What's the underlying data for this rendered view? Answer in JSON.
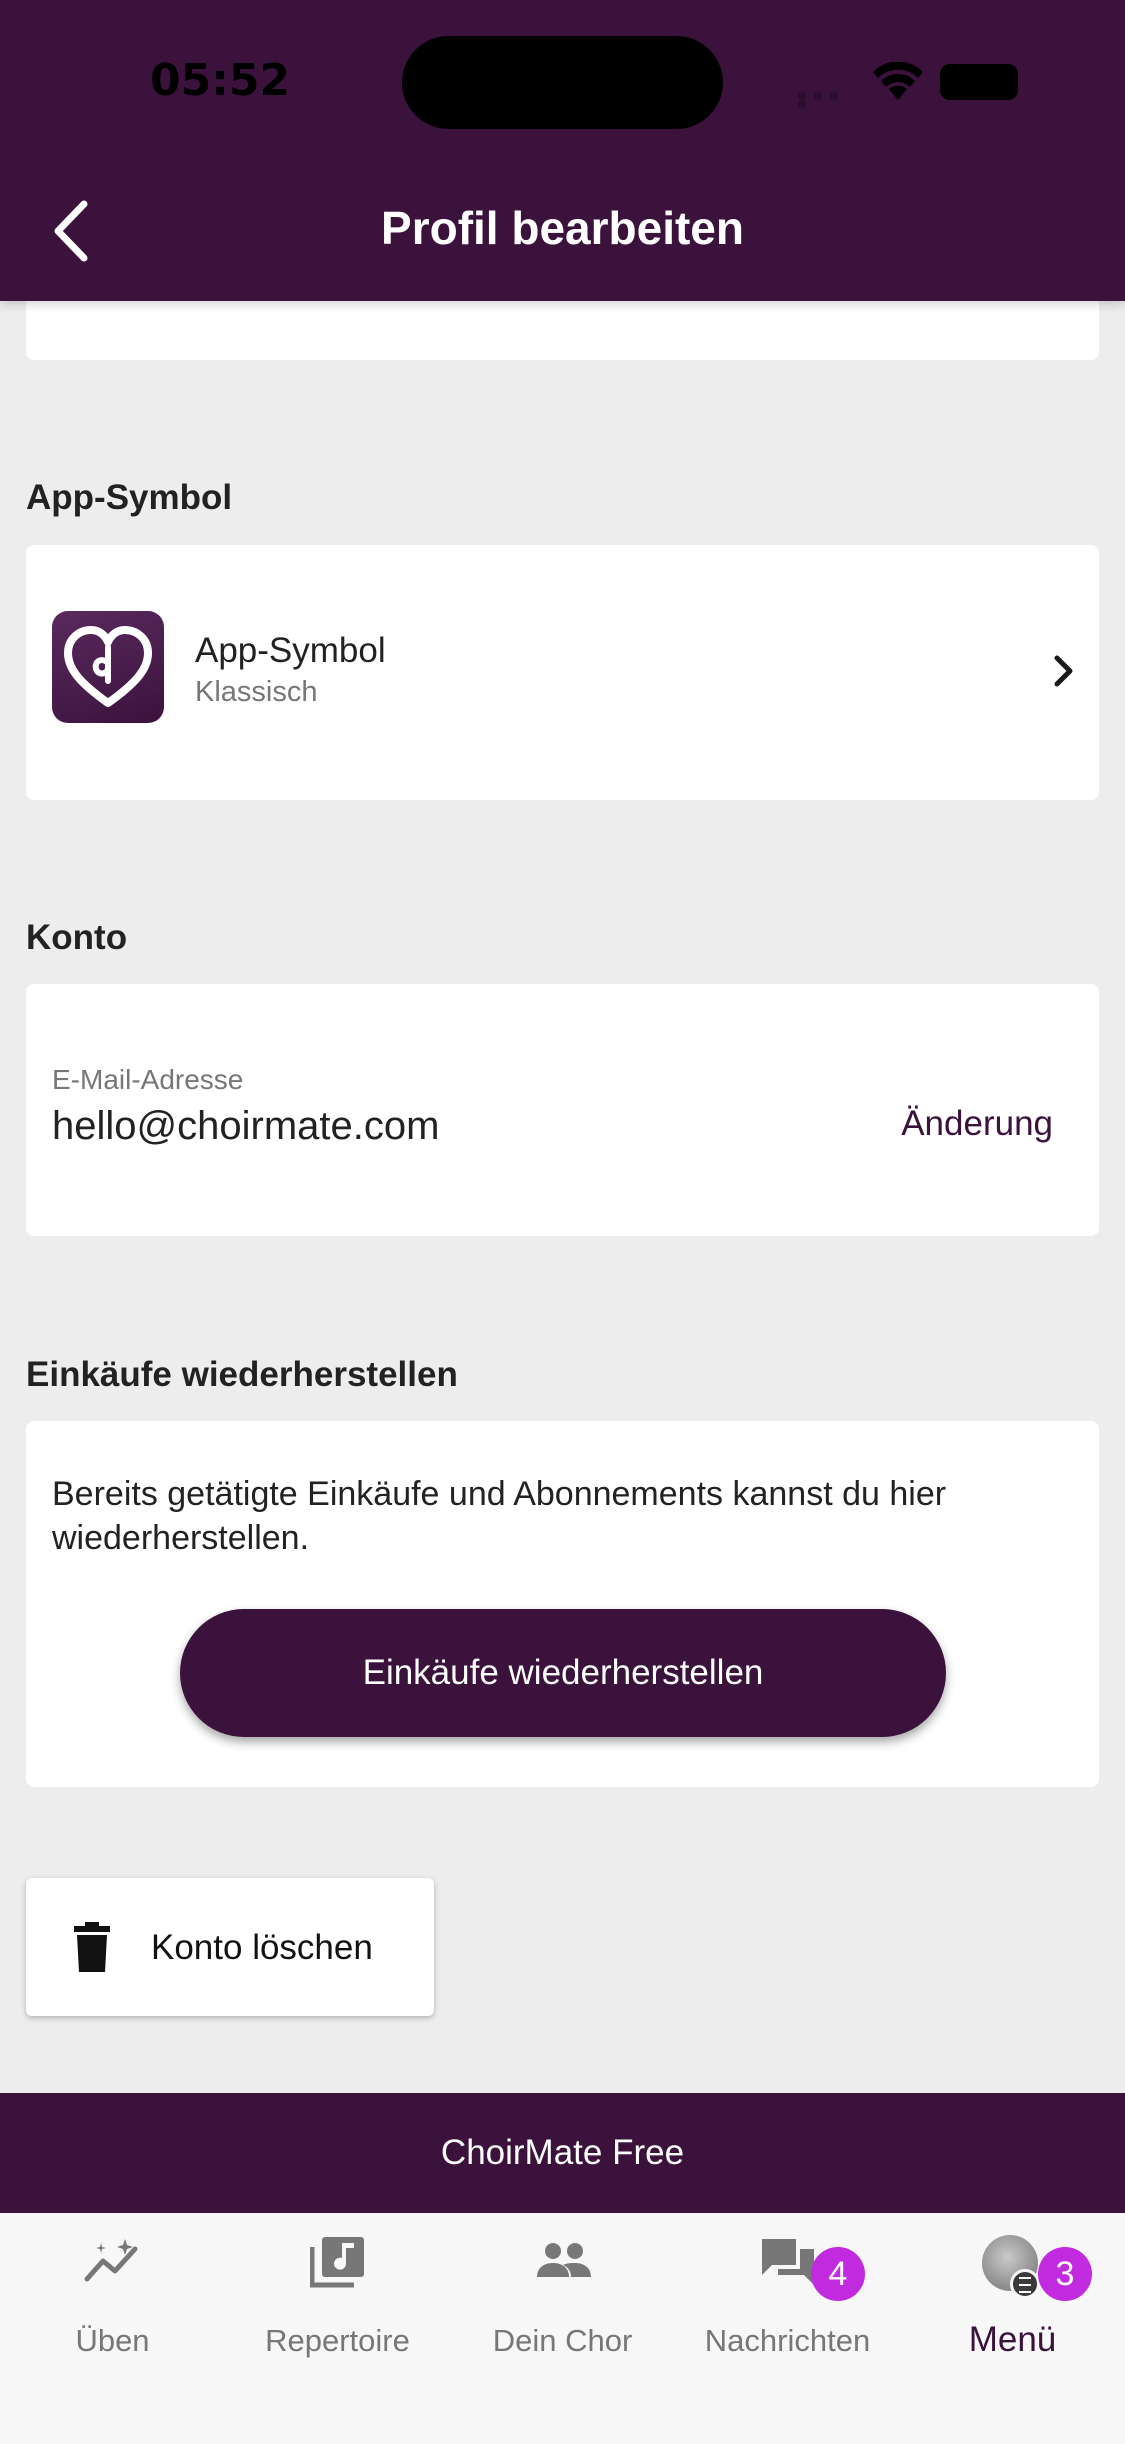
{
  "status_bar": {
    "time": "05:52"
  },
  "header": {
    "title": "Profil bearbeiten"
  },
  "app_icon_section": {
    "title": "App-Symbol",
    "row_title": "App-Symbol",
    "row_subtitle": "Klassisch"
  },
  "account_section": {
    "title": "Konto",
    "email_label": "E-Mail-Adresse",
    "email_value": "hello@choirmate.com",
    "change_label": "Änderung"
  },
  "restore_section": {
    "title": "Einkäufe wiederherstellen",
    "description": "Bereits getätigte Einkäufe und Abonnements kannst du hier wiederherstellen.",
    "button_label": "Einkäufe wiederherstellen"
  },
  "delete_account": {
    "label": "Konto löschen"
  },
  "plan_banner": {
    "label": "ChoirMate Free"
  },
  "tabbar": {
    "items": [
      {
        "label": "Üben",
        "icon": "practice-chart-icon"
      },
      {
        "label": "Repertoire",
        "icon": "music-library-icon"
      },
      {
        "label": "Dein Chor",
        "icon": "people-icon"
      },
      {
        "label": "Nachrichten",
        "icon": "chat-icon",
        "badge": "4"
      },
      {
        "label": "Menü",
        "icon": "avatar",
        "badge": "3",
        "active": true
      }
    ]
  },
  "colors": {
    "brand": "#3a123c",
    "badge": "#c22ae0",
    "background": "#ededed"
  }
}
